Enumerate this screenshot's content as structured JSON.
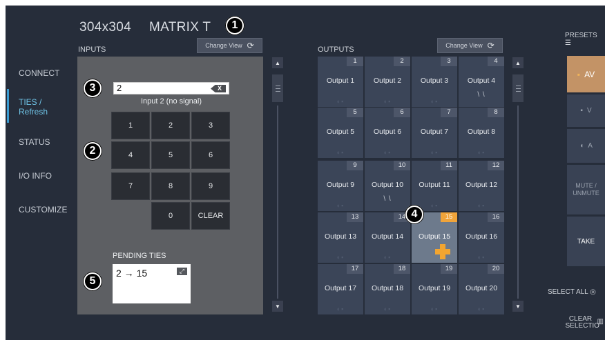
{
  "header": {
    "title_part1": "304x304",
    "title_part2": "MATRIX T",
    "presets_label": "PRESETS",
    "presets_icon": "sliders-icon"
  },
  "sidebar": {
    "items": [
      {
        "label": "CONNECT"
      },
      {
        "label": "TIES /",
        "label2": "Refresh",
        "active": true
      },
      {
        "label": "STATUS"
      },
      {
        "label": "I/O INFO"
      },
      {
        "label": "CUSTOMIZE"
      }
    ]
  },
  "inputs": {
    "label": "INPUTS",
    "change_view": "Change View",
    "search_value": "2",
    "backspace_icon": "X",
    "signal_text": "Input 2 (no signal)",
    "keys": [
      "1",
      "2",
      "3",
      "4",
      "5",
      "6",
      "7",
      "8",
      "9",
      "0",
      "CLEAR"
    ],
    "pending_label": "PENDING TIES",
    "pending_value": "2 → 15",
    "expand_icon": "⤢"
  },
  "outputs": {
    "label": "OUTPUTS",
    "change_view": "Change View",
    "cells": [
      {
        "num": "1",
        "name": "Output 1"
      },
      {
        "num": "2",
        "name": "Output 2"
      },
      {
        "num": "3",
        "name": "Output 3"
      },
      {
        "num": "4",
        "name": "Output 4",
        "mark": "\\ \\"
      },
      {
        "num": "5",
        "name": "Output 5"
      },
      {
        "num": "6",
        "name": "Output 6"
      },
      {
        "num": "7",
        "name": "Output 7"
      },
      {
        "num": "8",
        "name": "Output 8"
      },
      {
        "num": "9",
        "name": "Output 9"
      },
      {
        "num": "10",
        "name": "Output 10",
        "mark": "\\ \\"
      },
      {
        "num": "11",
        "name": "Output 11"
      },
      {
        "num": "12",
        "name": "Output 12"
      },
      {
        "num": "13",
        "name": "Output 13"
      },
      {
        "num": "14",
        "name": "Output 14"
      },
      {
        "num": "15",
        "name": "Output 15",
        "selected": true
      },
      {
        "num": "16",
        "name": "Output 16"
      },
      {
        "num": "17",
        "name": "Output 17"
      },
      {
        "num": "18",
        "name": "Output 18"
      },
      {
        "num": "19",
        "name": "Output 19"
      },
      {
        "num": "20",
        "name": "Output 20"
      }
    ]
  },
  "right_panel": {
    "av_label": "AV",
    "video_label": "V",
    "audio_label": "A",
    "mute_label": "MUTE / UNMUTE",
    "take_label": "TAKE",
    "select_all_label": "SELECT ALL",
    "clear_selection_label": "CLEAR SELECTIO"
  },
  "callouts": [
    "1",
    "2",
    "3",
    "4",
    "5"
  ],
  "colors": {
    "background": "#262d3a",
    "accent_orange": "#f0a43a",
    "active_blue": "#3a9bd1",
    "av_button": "#c39366"
  }
}
